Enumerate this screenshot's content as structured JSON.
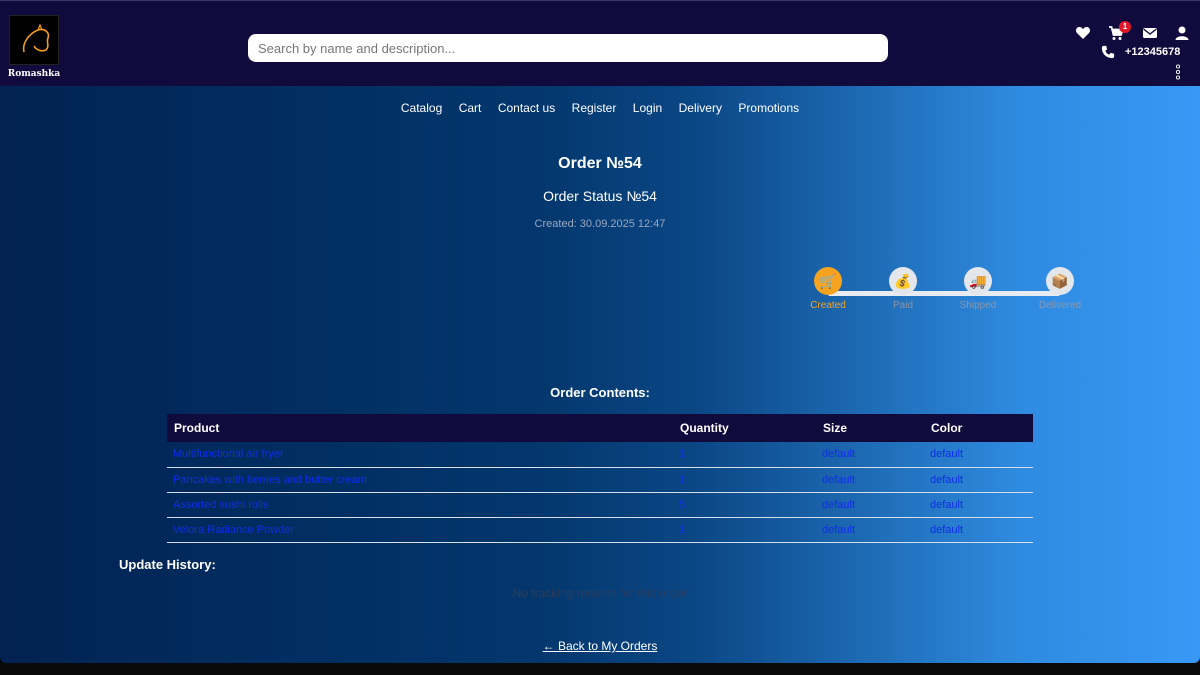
{
  "brand": {
    "name": "Romashka"
  },
  "header": {
    "search_placeholder": "Search by name and description...",
    "cart_count": "1",
    "phone": "+12345678"
  },
  "nav": [
    "Catalog",
    "Cart",
    "Contact us",
    "Register",
    "Login",
    "Delivery",
    "Promotions"
  ],
  "order": {
    "title": "Order №54",
    "status_title": "Order Status №54",
    "created": "Created: 30.09.2025 12:47"
  },
  "tracker": {
    "current_step": 0,
    "steps": [
      {
        "label": "Created",
        "icon": "🛒",
        "icon_name": "cart-icon"
      },
      {
        "label": "Paid",
        "icon": "💰",
        "icon_name": "money-bag-icon"
      },
      {
        "label": "Shipped",
        "icon": "🚚",
        "icon_name": "truck-icon"
      },
      {
        "label": "Delivered",
        "icon": "📦",
        "icon_name": "package-icon"
      }
    ]
  },
  "contents": {
    "title": "Order Contents:",
    "columns": [
      "Product",
      "Quantity",
      "Size",
      "Color"
    ],
    "rows": [
      [
        "Multifunctional air fryer",
        "1",
        "default",
        "default"
      ],
      [
        "Pancakes with berries and butter cream",
        "1",
        "default",
        "default"
      ],
      [
        "Assorted sushi rolls",
        "5",
        "default",
        "default"
      ],
      [
        "Velora Radiance Powder",
        "1",
        "default",
        "default"
      ]
    ]
  },
  "history": {
    "title": "Update History:",
    "empty": "No tracking records for this order"
  },
  "back_link": "← Back to My Orders",
  "colors": {
    "accent": "#f6a41f",
    "header_bg": "#110a3c",
    "link": "#0f2ee6"
  }
}
